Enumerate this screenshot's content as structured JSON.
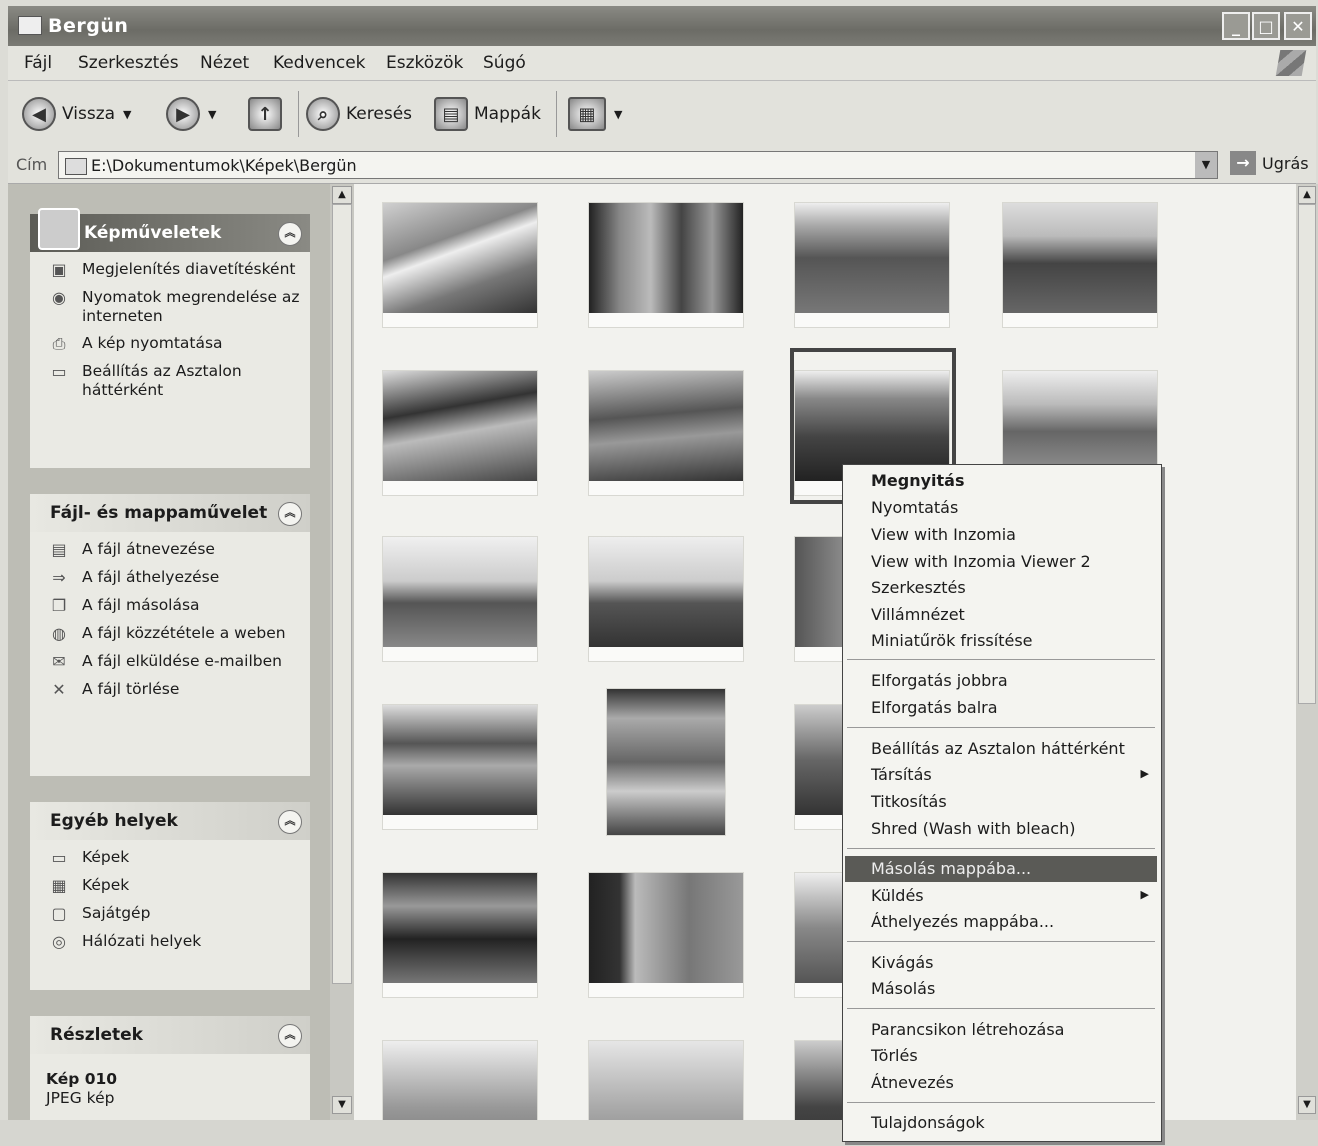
{
  "window": {
    "title": "Bergün"
  },
  "menu": [
    "Fájl",
    "Szerkesztés",
    "Nézet",
    "Kedvencek",
    "Eszközök",
    "Súgó"
  ],
  "toolbar": {
    "back": "Vissza",
    "search": "Keresés",
    "folders": "Mappák"
  },
  "address": {
    "label": "Cím",
    "path": "E:\\Dokumentumok\\Képek\\Bergün",
    "go": "Ugrás"
  },
  "panels": {
    "image_tasks": {
      "title": "Képműveletek",
      "items": [
        "Megjelenítés diavetítésként",
        "Nyomatok megrendelése az interneten",
        "A kép nyomtatása",
        "Beállítás az Asztalon háttérként"
      ]
    },
    "file_tasks": {
      "title": "Fájl- és mappaművelet",
      "items": [
        "A fájl átnevezése",
        "A fájl áthelyezése",
        "A fájl másolása",
        "A fájl közzététele a weben",
        "A fájl elküldése e-mailben",
        "A fájl törlése"
      ]
    },
    "other_places": {
      "title": "Egyéb helyek",
      "items": [
        "Képek",
        "Képek",
        "Sajátgép",
        "Hálózati helyek"
      ]
    },
    "details": {
      "title": "Részletek",
      "name": "Kép 010",
      "type": "JPEG kép"
    }
  },
  "context_menu": {
    "items": [
      "Megnyitás",
      "Nyomtatás",
      "View with Inzomia",
      "View with Inzomia Viewer 2",
      "Szerkesztés",
      "Villámnézet",
      "Miniatűrök frissítése",
      "Elforgatás jobbra",
      "Elforgatás balra",
      "Beállítás az Asztalon háttérként",
      "Társítás",
      "Titkosítás",
      "Shred (Wash with bleach)",
      "Másolás mappába...",
      "Küldés",
      "Áthelyezés mappába...",
      "Kivágás",
      "Másolás",
      "Parancsikon létrehozása",
      "Törlés",
      "Átnevezés",
      "Tulajdonságok"
    ],
    "highlighted": "Másolás mappába..."
  }
}
